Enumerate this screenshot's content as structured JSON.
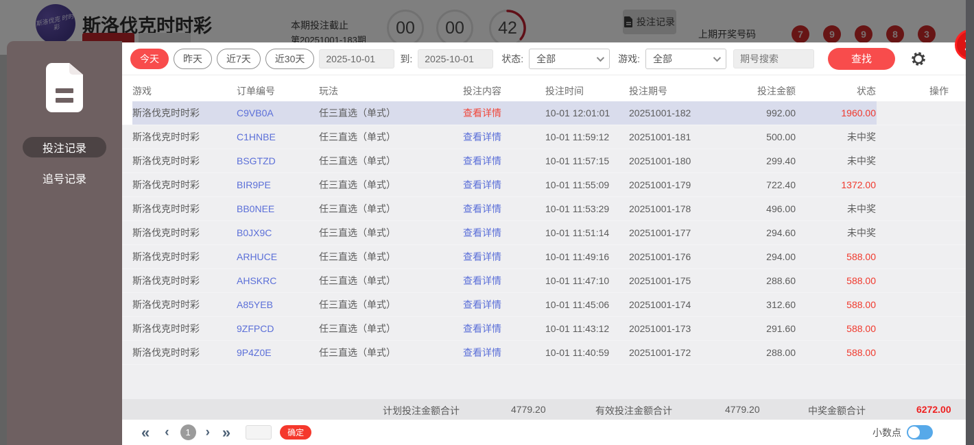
{
  "background": {
    "lottery_title": "斯洛伐克时时彩",
    "logo_text": "斯洛伐克 时时彩",
    "deadline_label": "本期投注截止",
    "period_label": "第20251001-183期",
    "countdown": {
      "hours": "00",
      "minutes": "00",
      "seconds": "42"
    },
    "records_button": "投注记录",
    "last_draw_label": "上期开奖号码",
    "last_draw_numbers": [
      "7",
      "9",
      "9",
      "8",
      "3"
    ]
  },
  "sidebar": {
    "items": [
      {
        "label": "投注记录",
        "active": true
      },
      {
        "label": "追号记录",
        "active": false
      }
    ]
  },
  "filters": {
    "quick_ranges": [
      {
        "label": "今天",
        "active": true
      },
      {
        "label": "昨天",
        "active": false
      },
      {
        "label": "近7天",
        "active": false
      },
      {
        "label": "近30天",
        "active": false
      }
    ],
    "date_from": "2025-10-01",
    "to_label": "到:",
    "date_to": "2025-10-01",
    "status_label": "状态:",
    "status_value": "全部",
    "game_label": "游戏:",
    "game_value": "全部",
    "search_placeholder": "期号搜索",
    "search_button": "查找"
  },
  "table": {
    "columns": [
      "游戏",
      "订单编号",
      "玩法",
      "投注内容",
      "投注时间",
      "投注期号",
      "投注金额",
      "状态",
      "操作"
    ],
    "rows": [
      {
        "game": "斯洛伐克时时彩",
        "order": "C9VB0A",
        "play": "任三直选（单式）",
        "content": "查看详情",
        "time": "10-01 12:01:01",
        "period": "20251001-182",
        "amount": "992.00",
        "status": "1960.00",
        "status_win": true,
        "content_red": true,
        "highlighted": true
      },
      {
        "game": "斯洛伐克时时彩",
        "order": "C1HNBE",
        "play": "任三直选（单式）",
        "content": "查看详情",
        "time": "10-01 11:59:12",
        "period": "20251001-181",
        "amount": "500.00",
        "status": "未中奖",
        "status_win": false,
        "content_red": false,
        "highlighted": false
      },
      {
        "game": "斯洛伐克时时彩",
        "order": "BSGTZD",
        "play": "任三直选（单式）",
        "content": "查看详情",
        "time": "10-01 11:57:15",
        "period": "20251001-180",
        "amount": "299.40",
        "status": "未中奖",
        "status_win": false,
        "content_red": false,
        "highlighted": false
      },
      {
        "game": "斯洛伐克时时彩",
        "order": "BIR9PE",
        "play": "任三直选（单式）",
        "content": "查看详情",
        "time": "10-01 11:55:09",
        "period": "20251001-179",
        "amount": "722.40",
        "status": "1372.00",
        "status_win": true,
        "content_red": false,
        "highlighted": false
      },
      {
        "game": "斯洛伐克时时彩",
        "order": "BB0NEE",
        "play": "任三直选（单式）",
        "content": "查看详情",
        "time": "10-01 11:53:29",
        "period": "20251001-178",
        "amount": "496.00",
        "status": "未中奖",
        "status_win": false,
        "content_red": false,
        "highlighted": false
      },
      {
        "game": "斯洛伐克时时彩",
        "order": "B0JX9C",
        "play": "任三直选（单式）",
        "content": "查看详情",
        "time": "10-01 11:51:14",
        "period": "20251001-177",
        "amount": "294.60",
        "status": "未中奖",
        "status_win": false,
        "content_red": false,
        "highlighted": false
      },
      {
        "game": "斯洛伐克时时彩",
        "order": "ARHUCE",
        "play": "任三直选（单式）",
        "content": "查看详情",
        "time": "10-01 11:49:16",
        "period": "20251001-176",
        "amount": "294.00",
        "status": "588.00",
        "status_win": true,
        "content_red": false,
        "highlighted": false
      },
      {
        "game": "斯洛伐克时时彩",
        "order": "AHSKRC",
        "play": "任三直选（单式）",
        "content": "查看详情",
        "time": "10-01 11:47:10",
        "period": "20251001-175",
        "amount": "288.60",
        "status": "588.00",
        "status_win": true,
        "content_red": false,
        "highlighted": false
      },
      {
        "game": "斯洛伐克时时彩",
        "order": "A85YEB",
        "play": "任三直选（单式）",
        "content": "查看详情",
        "time": "10-01 11:45:06",
        "period": "20251001-174",
        "amount": "312.60",
        "status": "588.00",
        "status_win": true,
        "content_red": false,
        "highlighted": false
      },
      {
        "game": "斯洛伐克时时彩",
        "order": "9ZFPCD",
        "play": "任三直选（单式）",
        "content": "查看详情",
        "time": "10-01 11:43:12",
        "period": "20251001-173",
        "amount": "291.60",
        "status": "588.00",
        "status_win": true,
        "content_red": false,
        "highlighted": false
      },
      {
        "game": "斯洛伐克时时彩",
        "order": "9P4Z0E",
        "play": "任三直选（单式）",
        "content": "查看详情",
        "time": "10-01 11:40:59",
        "period": "20251001-172",
        "amount": "288.00",
        "status": "588.00",
        "status_win": true,
        "content_red": false,
        "highlighted": false
      }
    ]
  },
  "summary": {
    "planned_label": "计划投注金额合计",
    "planned_value": "4779.20",
    "valid_label": "有效投注金额合计",
    "valid_value": "4779.20",
    "win_label": "中奖金额合计",
    "win_value": "6272.00"
  },
  "pagination": {
    "current_page": "1",
    "confirm_button": "确定"
  },
  "footer": {
    "decimal_label": "小数点"
  },
  "colors": {
    "accent_red": "#f84c4c",
    "link_blue": "#5b6fd8",
    "win_red": "#f0382c",
    "sidebar_taupe": "#6e6061",
    "toggle_blue": "#57a9e9",
    "highlight_row": "#d9dcec"
  }
}
